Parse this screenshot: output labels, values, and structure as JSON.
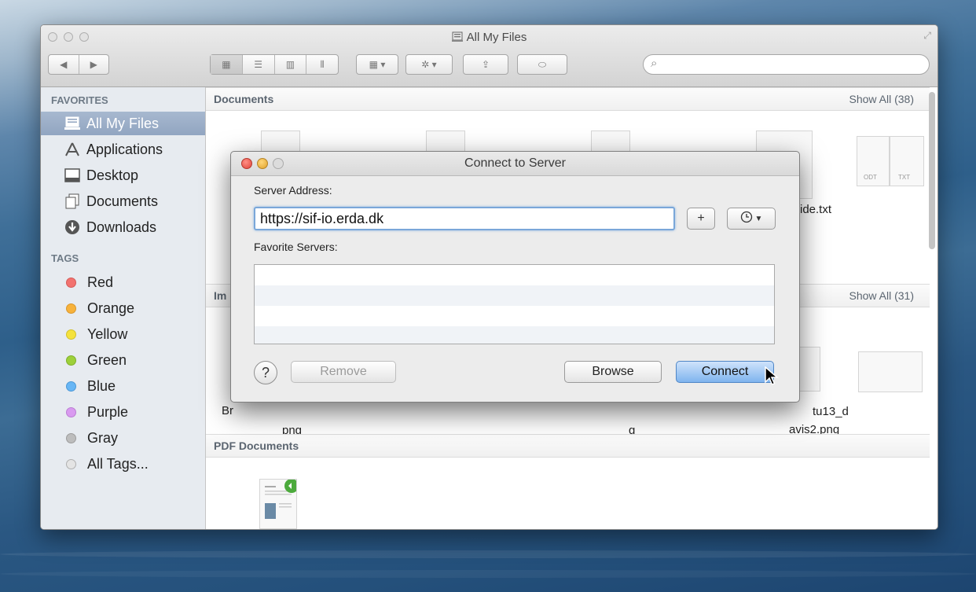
{
  "finder": {
    "title": "All My Files",
    "search_placeholder": "",
    "sidebar": {
      "favorites_header": "FAVORITES",
      "favorites": [
        {
          "label": "All My Files",
          "icon": "all-my-files-icon",
          "selected": true
        },
        {
          "label": "Applications",
          "icon": "applications-icon"
        },
        {
          "label": "Desktop",
          "icon": "desktop-icon"
        },
        {
          "label": "Documents",
          "icon": "documents-icon"
        },
        {
          "label": "Downloads",
          "icon": "downloads-icon"
        }
      ],
      "tags_header": "TAGS",
      "tags": [
        {
          "label": "Red",
          "color": "#f2726f"
        },
        {
          "label": "Orange",
          "color": "#f7b23b"
        },
        {
          "label": "Yellow",
          "color": "#f5e23d"
        },
        {
          "label": "Green",
          "color": "#9dd03a"
        },
        {
          "label": "Blue",
          "color": "#68b6f5"
        },
        {
          "label": "Purple",
          "color": "#d99af0"
        },
        {
          "label": "Gray",
          "color": "#bdbdbd"
        },
        {
          "label": "All Tags...",
          "color": "#e4e4e4"
        }
      ]
    },
    "sections": {
      "documents": {
        "title": "Documents",
        "show_all": "Show All (38)",
        "visible_file_fragment": "ide.txt",
        "doc_badges": [
          "ODT",
          "TXT"
        ]
      },
      "images": {
        "title_fragment": "Im",
        "show_all": "Show All (31)",
        "file_fragments": [
          "Br",
          "png",
          "g",
          "tu13_d",
          "avis2.png"
        ]
      },
      "pdf": {
        "title": "PDF Documents"
      }
    }
  },
  "dialog": {
    "title": "Connect to Server",
    "server_address_label": "Server Address:",
    "server_address_value": "https://sif-io.erda.dk",
    "add_button": "+",
    "favorite_servers_label": "Favorite Servers:",
    "help_button": "?",
    "remove_button": "Remove",
    "browse_button": "Browse",
    "connect_button": "Connect"
  }
}
